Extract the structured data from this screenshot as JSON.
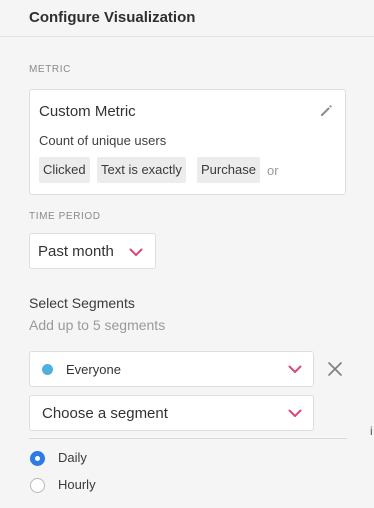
{
  "header": {
    "title": "Configure Visualization"
  },
  "metric": {
    "section_label": "METRIC",
    "title": "Custom Metric",
    "edit_icon": "pencil-icon",
    "description": "Count of unique users",
    "chips": [
      "Clicked",
      "Text is exactly",
      "Purchase"
    ],
    "or_label": "or"
  },
  "time_period": {
    "section_label": "TIME PERIOD",
    "selected": "Past month",
    "dropdown_icon": "chevron-down-icon"
  },
  "segments": {
    "title": "Select Segments",
    "subtitle": "Add up to 5 segments",
    "selected_segment": "Everyone",
    "segment_dot_color": "#4fb0e0",
    "remove_icon": "close-icon",
    "placeholder": "Choose a segment"
  },
  "interval": {
    "options": [
      "Daily",
      "Hourly"
    ],
    "selected": "Daily"
  },
  "colors": {
    "accent_chevron": "#d9487d",
    "radio_selected": "#2d7be5"
  },
  "edge_fragment": "i"
}
